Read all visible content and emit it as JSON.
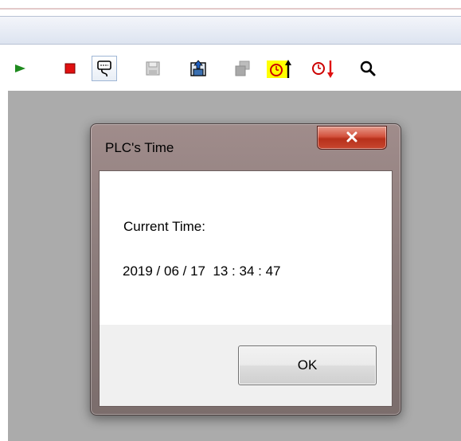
{
  "toolbar": {
    "buttons": [
      {
        "icon": "run-icon",
        "color": "#1e8a1e"
      },
      {
        "icon": "stop-icon",
        "color": "#e01010"
      },
      {
        "icon": "monitor-icon",
        "pressed": true
      },
      {
        "icon": "read-plc-icon"
      },
      {
        "icon": "upload-icon"
      },
      {
        "icon": "download-icon"
      },
      {
        "icon": "set-plc-time-icon",
        "highlight": "#ffff00"
      },
      {
        "icon": "read-plc-time-icon",
        "color": "#e01010"
      },
      {
        "icon": "search-icon"
      }
    ]
  },
  "dialog": {
    "title": "PLC's Time",
    "close_glyph": "X",
    "current_time_label": "Current Time:",
    "current_time_value": "2019 / 06 / 17  13 : 34 : 47",
    "ok_label": "OK"
  },
  "colors": {
    "workspace": "#ababab",
    "dialog_frame": "#8f7f7e",
    "close_button": "#c7462f"
  }
}
